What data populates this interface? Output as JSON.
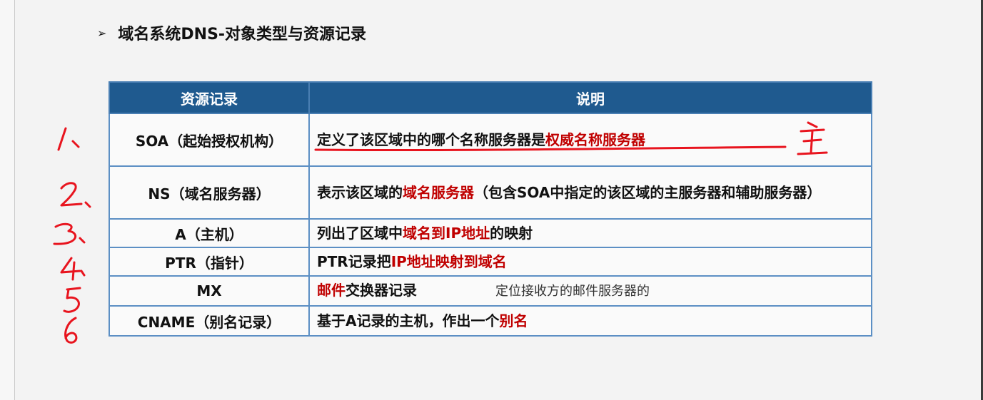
{
  "title": {
    "bullet": "➢",
    "text": "域名系统DNS-对象类型与资源记录"
  },
  "table": {
    "headers": [
      "资源记录",
      "说明"
    ],
    "rows": [
      {
        "record": "SOA（起始授权机构）",
        "desc": [
          {
            "t": "定义了该区域中的哪个名称服务器是"
          },
          {
            "t": "权威名称服务器",
            "hl": true
          }
        ]
      },
      {
        "record": "NS（域名服务器）",
        "desc": [
          {
            "t": "表示该区域的"
          },
          {
            "t": "域名服务器",
            "hl": true
          },
          {
            "t": "（包含SOA中指定的该区域的主服务器和辅助服务器）"
          }
        ]
      },
      {
        "record": "A（主机）",
        "desc": [
          {
            "t": "列出了区域中"
          },
          {
            "t": "域名到IP地址",
            "hl": true
          },
          {
            "t": "的映射"
          }
        ]
      },
      {
        "record": "PTR（指针）",
        "desc": [
          {
            "t": "PTR记录把"
          },
          {
            "t": "IP地址映射到域名",
            "hl": true
          }
        ]
      },
      {
        "record": "MX",
        "desc": [
          {
            "t": "邮件",
            "hl": true
          },
          {
            "t": "交换器记录"
          }
        ],
        "note": "定位接收方的邮件服务器的"
      },
      {
        "record": "CNAME（别名记录）",
        "desc": [
          {
            "t": "基于A记录的主机，作出一个"
          },
          {
            "t": "别名",
            "hl": true
          }
        ]
      }
    ]
  },
  "annotations": {
    "numbers": [
      "1、",
      "2、",
      "3、",
      "4、",
      "5",
      "6"
    ],
    "soa_mark": "主",
    "ink_color": "#e8141e"
  },
  "colors": {
    "header_bg": "#1f5a8f",
    "highlight": "#c00000",
    "table_border": "#5c8fc4"
  }
}
